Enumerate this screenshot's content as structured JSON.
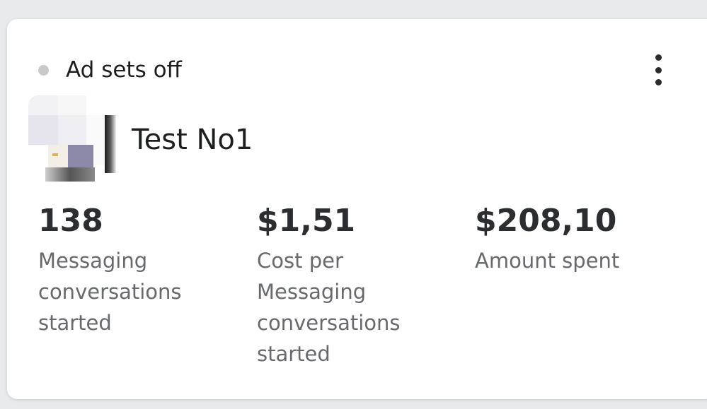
{
  "card": {
    "status_text": "Ad sets off",
    "status_dot_color": "#c9c9c9",
    "more_icon": "more-vertical-icon",
    "campaign_name": "Test No1",
    "metrics": [
      {
        "value": "138",
        "label_lines": [
          "Messaging",
          "conversations",
          "started"
        ]
      },
      {
        "value": "$1,51",
        "label_lines": [
          "Cost per",
          "Messaging",
          "conversations",
          "started"
        ]
      },
      {
        "value": "$208,10",
        "label_lines": [
          "Amount spent"
        ]
      }
    ]
  }
}
